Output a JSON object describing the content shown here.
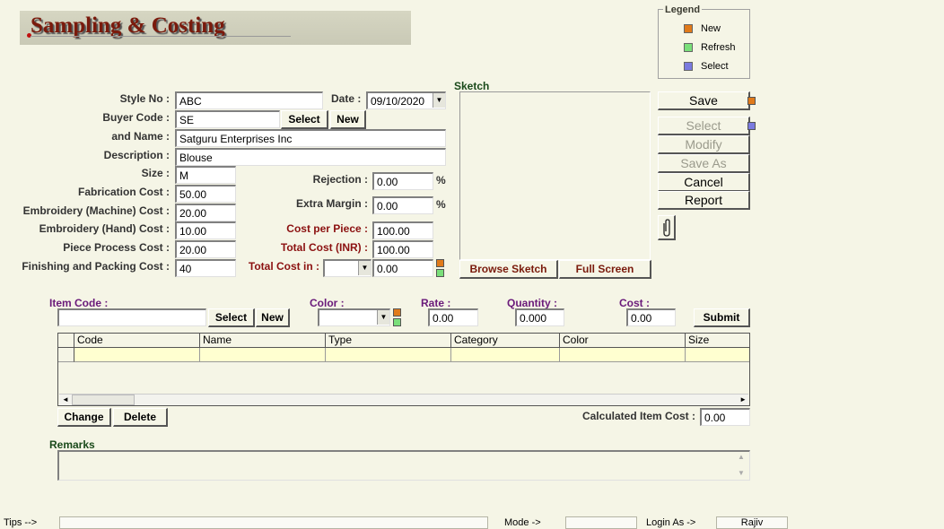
{
  "title": "Sampling & Costing",
  "legend": {
    "title": "Legend",
    "items": [
      {
        "label": "New",
        "color": "#e07a1a"
      },
      {
        "label": "Refresh",
        "color": "#7adf7a"
      },
      {
        "label": "Select",
        "color": "#7a7adf"
      }
    ]
  },
  "form": {
    "style_no_label": "Style No :",
    "style_no": "ABC",
    "date_label": "Date :",
    "date": "09/10/2020",
    "buyer_code_label": "Buyer Code :",
    "buyer_code": "SE",
    "select_label": "Select",
    "new_label": "New",
    "name_label": "and Name :",
    "name": "Satguru Enterprises Inc",
    "description_label": "Description :",
    "description": "Blouse",
    "size_label": "Size :",
    "size": "M",
    "fabrication_cost_label": "Fabrication Cost :",
    "fabrication_cost": "50.00",
    "emb_machine_label": "Embroidery (Machine) Cost :",
    "emb_machine": "20.00",
    "emb_hand_label": "Embroidery (Hand) Cost :",
    "emb_hand": "10.00",
    "piece_process_label": "Piece Process Cost :",
    "piece_process": "20.00",
    "finishing_label": "Finishing and Packing Cost :",
    "finishing": "40",
    "rejection_label": "Rejection :",
    "rejection": "0.00",
    "extra_margin_label": "Extra Margin :",
    "extra_margin": "0.00",
    "percent": "%",
    "cost_per_piece_label": "Cost per Piece :",
    "cost_per_piece": "100.00",
    "total_cost_inr_label": "Total Cost (INR) :",
    "total_cost_inr": "100.00",
    "total_cost_in_label": "Total Cost in :",
    "total_cost_in_currency": "",
    "total_cost_in": "0.00"
  },
  "sketch": {
    "label": "Sketch",
    "browse_label": "Browse Sketch",
    "fullscreen_label": "Full Screen"
  },
  "actions": {
    "save": "Save",
    "select": "Select",
    "modify": "Modify",
    "save_as": "Save As",
    "cancel": "Cancel",
    "report": "Report",
    "attach_icon": "paperclip-icon"
  },
  "item": {
    "item_code_label": "Item Code :",
    "item_code": "",
    "select_label": "Select",
    "new_label": "New",
    "color_label": "Color :",
    "color": "",
    "rate_label": "Rate :",
    "rate": "0.00",
    "quantity_label": "Quantity :",
    "quantity": "0.000",
    "cost_label": "Cost :",
    "cost": "0.00",
    "submit_label": "Submit"
  },
  "grid": {
    "columns": [
      "Code",
      "Name",
      "Type",
      "Category",
      "Color",
      "Size"
    ]
  },
  "grid_actions": {
    "change": "Change",
    "delete": "Delete",
    "calc_label": "Calculated Item Cost :",
    "calc_value": "0.00"
  },
  "remarks": {
    "label": "Remarks",
    "value": ""
  },
  "status": {
    "tips_label": "Tips -->",
    "tips": "",
    "mode_label": "Mode ->",
    "mode": "",
    "login_label": "Login As ->",
    "login": "Rajiv"
  }
}
